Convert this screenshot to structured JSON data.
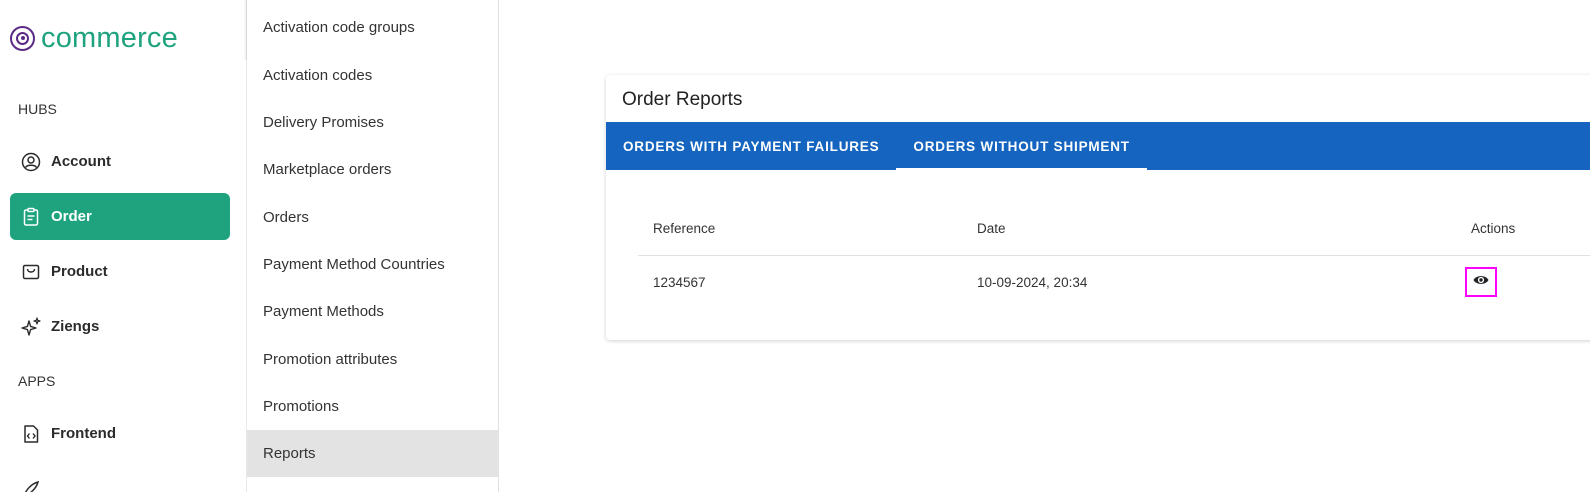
{
  "brand": {
    "name": "commerce",
    "color": "#1ea37e",
    "mark_color": "#5b2a86"
  },
  "sidebar": {
    "hubs_label": "HUBS",
    "hubs": [
      {
        "label": "Account",
        "icon": "account-circle-icon"
      },
      {
        "label": "Order",
        "icon": "clipboard-icon",
        "active": true
      },
      {
        "label": "Product",
        "icon": "shopping-bag-icon"
      },
      {
        "label": "Ziengs",
        "icon": "sparkle-icon"
      }
    ],
    "apps_label": "APPS",
    "apps": [
      {
        "label": "Frontend",
        "icon": "code-file-icon"
      }
    ]
  },
  "submenu": {
    "items": [
      "Activation code groups",
      "Activation codes",
      "Delivery Promises",
      "Marketplace orders",
      "Orders",
      "Payment Method Countries",
      "Payment Methods",
      "Promotion attributes",
      "Promotions",
      "Reports"
    ],
    "selected": "Reports"
  },
  "card": {
    "title": "Order Reports",
    "tabs": [
      "ORDERS WITH PAYMENT FAILURES",
      "ORDERS WITHOUT SHIPMENT"
    ],
    "active_tab": "ORDERS WITHOUT SHIPMENT",
    "tab_bar_color": "#1565c0",
    "table": {
      "headers": {
        "reference": "Reference",
        "date": "Date",
        "actions": "Actions"
      },
      "rows": [
        {
          "reference": "1234567",
          "date": "10-09-2024, 20:34",
          "action_icon": "eye-icon"
        }
      ]
    }
  }
}
